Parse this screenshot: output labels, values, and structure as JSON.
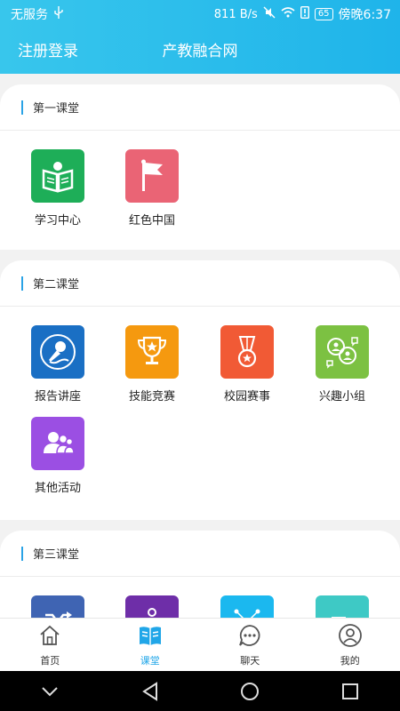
{
  "status_bar": {
    "carrier": "无服务",
    "usb_icon": "usb-icon",
    "speed": "811 B/s",
    "battery": "65",
    "time": "傍晚6:37"
  },
  "header": {
    "login": "注册登录",
    "title": "产教融合网"
  },
  "colors": {
    "header_start": "#38c6ec",
    "header_end": "#1fb4ea",
    "accent": "#20a6e8"
  },
  "sections": [
    {
      "title": "第一课堂",
      "items": [
        {
          "label": "学习中心",
          "icon": "book-reader-icon",
          "color": "#1eae58"
        },
        {
          "label": "红色中国",
          "icon": "flag-icon",
          "color": "#ea6475"
        }
      ]
    },
    {
      "title": "第二课堂",
      "items": [
        {
          "label": "报告讲座",
          "icon": "microphone-icon",
          "color": "#1a6fc4"
        },
        {
          "label": "技能竞赛",
          "icon": "trophy-icon",
          "color": "#f5990f"
        },
        {
          "label": "校园赛事",
          "icon": "medal-icon",
          "color": "#f15a35"
        },
        {
          "label": "兴趣小组",
          "icon": "group-chat-icon",
          "color": "#7cc142"
        },
        {
          "label": "其他活动",
          "icon": "people-icon",
          "color": "#9b4fe3"
        }
      ]
    },
    {
      "title": "第三课堂",
      "items": [
        {
          "label": "",
          "icon": "shuffle-icon",
          "color": "#3f64b3"
        },
        {
          "label": "",
          "icon": "person-icon",
          "color": "#6e2ea8"
        },
        {
          "label": "",
          "icon": "network-icon",
          "color": "#1bb8ef"
        },
        {
          "label": "",
          "icon": "chart-icon",
          "color": "#3ec9c5"
        }
      ]
    }
  ],
  "tabbar": {
    "items": [
      {
        "label": "首页",
        "icon": "home-icon"
      },
      {
        "label": "课堂",
        "icon": "classroom-icon"
      },
      {
        "label": "聊天",
        "icon": "chat-icon"
      },
      {
        "label": "我的",
        "icon": "profile-icon"
      }
    ],
    "active": 1
  },
  "system_nav": {
    "items": [
      "collapse-icon",
      "back-icon",
      "home-circle-icon",
      "recents-icon"
    ]
  }
}
